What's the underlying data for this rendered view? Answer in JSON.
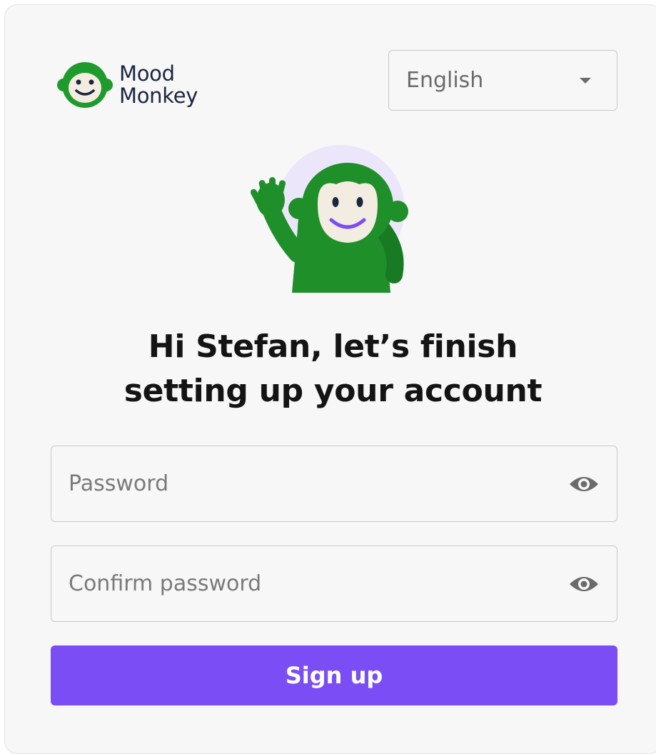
{
  "brand": {
    "name_line1": "Mood",
    "name_line2": "Monkey",
    "color": "#1f9a2c"
  },
  "language_select": {
    "value": "English"
  },
  "heading": {
    "line1": "Hi Stefan, let’s finish",
    "line2": "setting up your account"
  },
  "form": {
    "password_placeholder": "Password",
    "confirm_placeholder": "Confirm password",
    "submit_label": "Sign up"
  },
  "colors": {
    "accent": "#7b4df5",
    "mascot_green": "#1f8f2a",
    "halo": "#ece6fb"
  }
}
